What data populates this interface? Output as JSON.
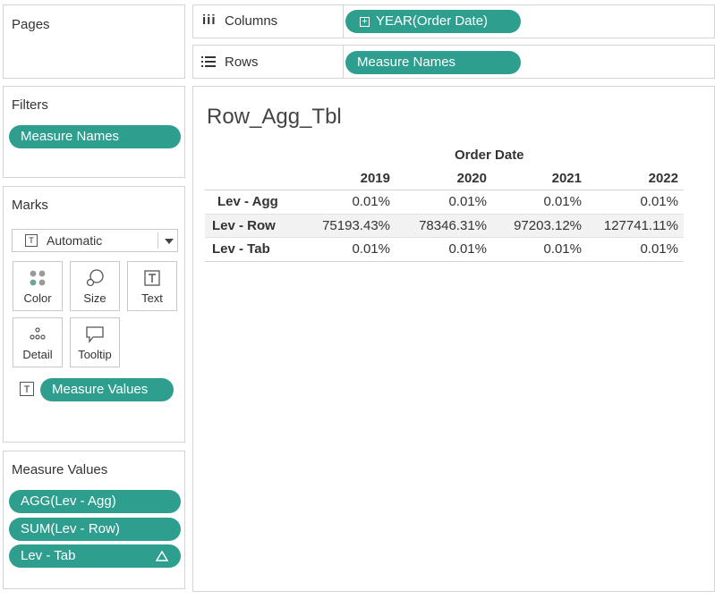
{
  "pages": {
    "title": "Pages"
  },
  "filters": {
    "title": "Filters",
    "pill": "Measure Names"
  },
  "marks": {
    "title": "Marks",
    "mark_type": "Automatic",
    "buttons": [
      "Color",
      "Size",
      "Text",
      "Detail",
      "Tooltip"
    ],
    "text_pill": "Measure Values"
  },
  "measure_values_card": {
    "title": "Measure Values",
    "pills": [
      "AGG(Lev - Agg)",
      "SUM(Lev - Row)",
      "Lev - Tab"
    ]
  },
  "columns_shelf": {
    "label": "Columns",
    "pill": "YEAR(Order Date)"
  },
  "rows_shelf": {
    "label": "Rows",
    "pill": "Measure Names"
  },
  "view": {
    "title": "Row_Agg_Tbl",
    "column_group_header": "Order Date",
    "years": [
      "2019",
      "2020",
      "2021",
      "2022"
    ],
    "rows": [
      {
        "label": "Lev - Agg",
        "values": [
          "0.01%",
          "0.01%",
          "0.01%",
          "0.01%"
        ]
      },
      {
        "label": "Lev - Row",
        "values": [
          "75193.43%",
          "78346.31%",
          "97203.12%",
          "127741.11%"
        ]
      },
      {
        "label": "Lev - Tab",
        "values": [
          "0.01%",
          "0.01%",
          "0.01%",
          "0.01%"
        ]
      }
    ]
  },
  "colors": {
    "pill": "#2e9e8e",
    "highlight_row": "#f2f2f2"
  }
}
